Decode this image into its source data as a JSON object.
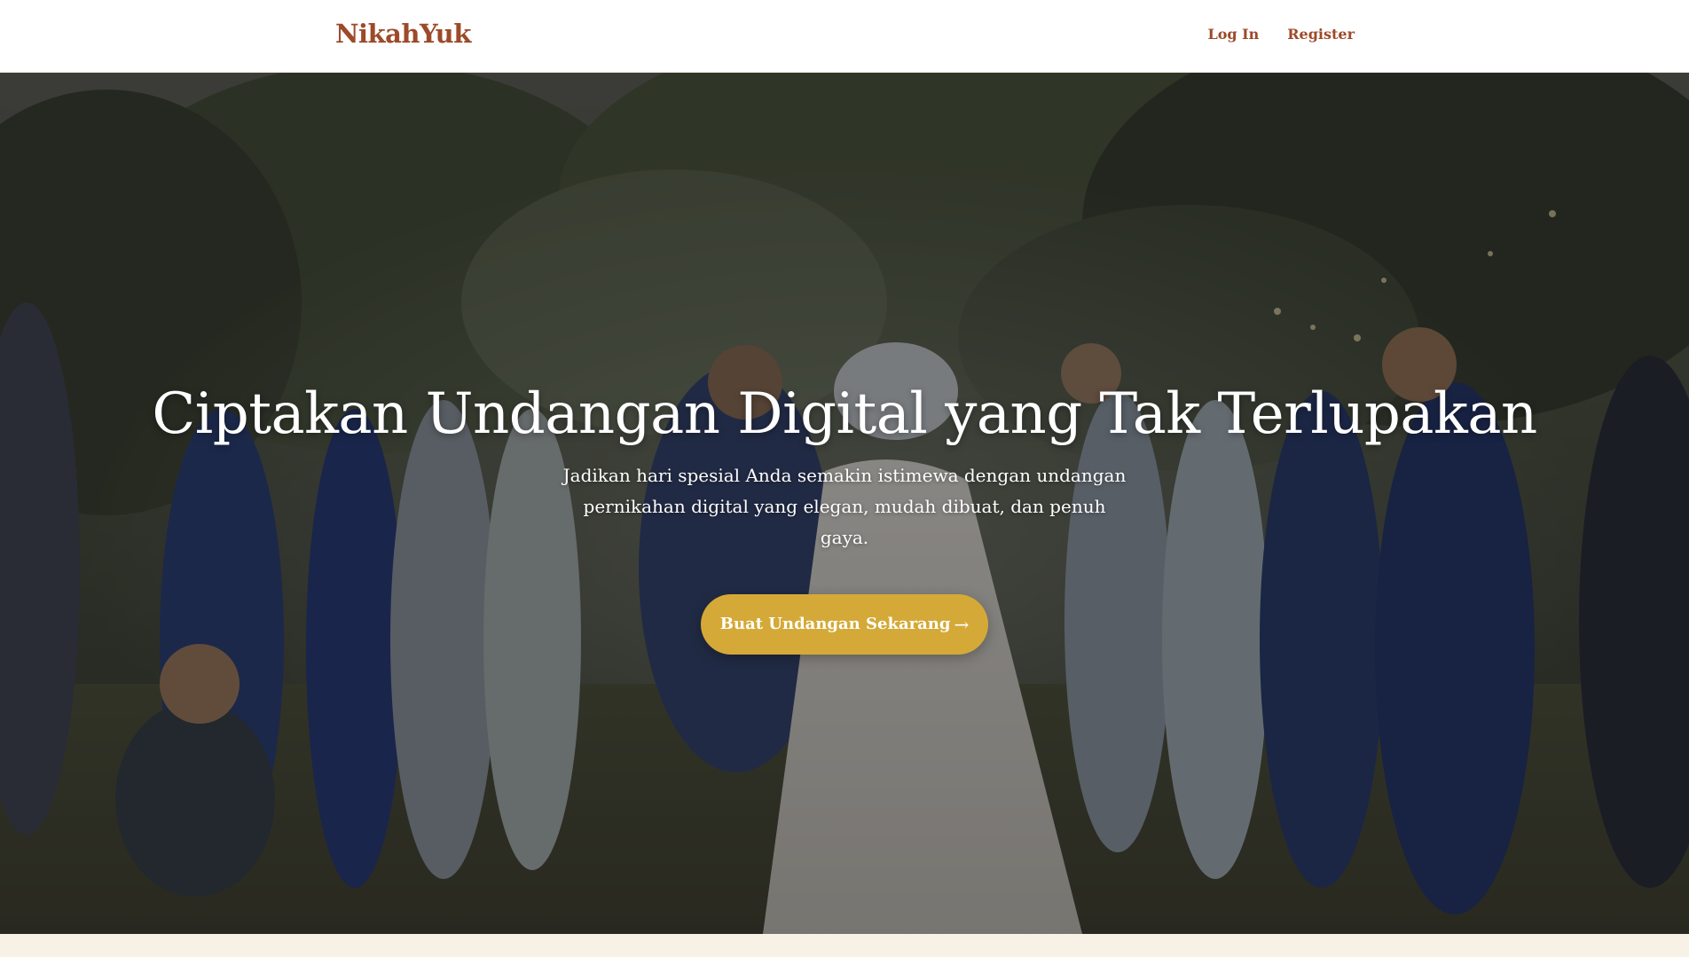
{
  "header": {
    "brand": "NikahYuk",
    "nav": {
      "login": "Log In",
      "register": "Register"
    }
  },
  "hero": {
    "title": "Ciptakan Undangan Digital yang Tak Terlupakan",
    "subtitle": "Jadikan hari spesial Anda semakin istimewa dengan undangan pernikahan digital yang elegan, mudah dibuat, dan penuh gaya.",
    "cta_label": "Buat Undangan Sekarang",
    "cta_arrow": "→"
  },
  "colors": {
    "brand": "#9c4a2a",
    "accent": "#d4a937",
    "page_background": "#f7f1e6",
    "header_background": "#ffffff"
  },
  "icons": {
    "cta_arrow": "arrow-right-icon"
  }
}
